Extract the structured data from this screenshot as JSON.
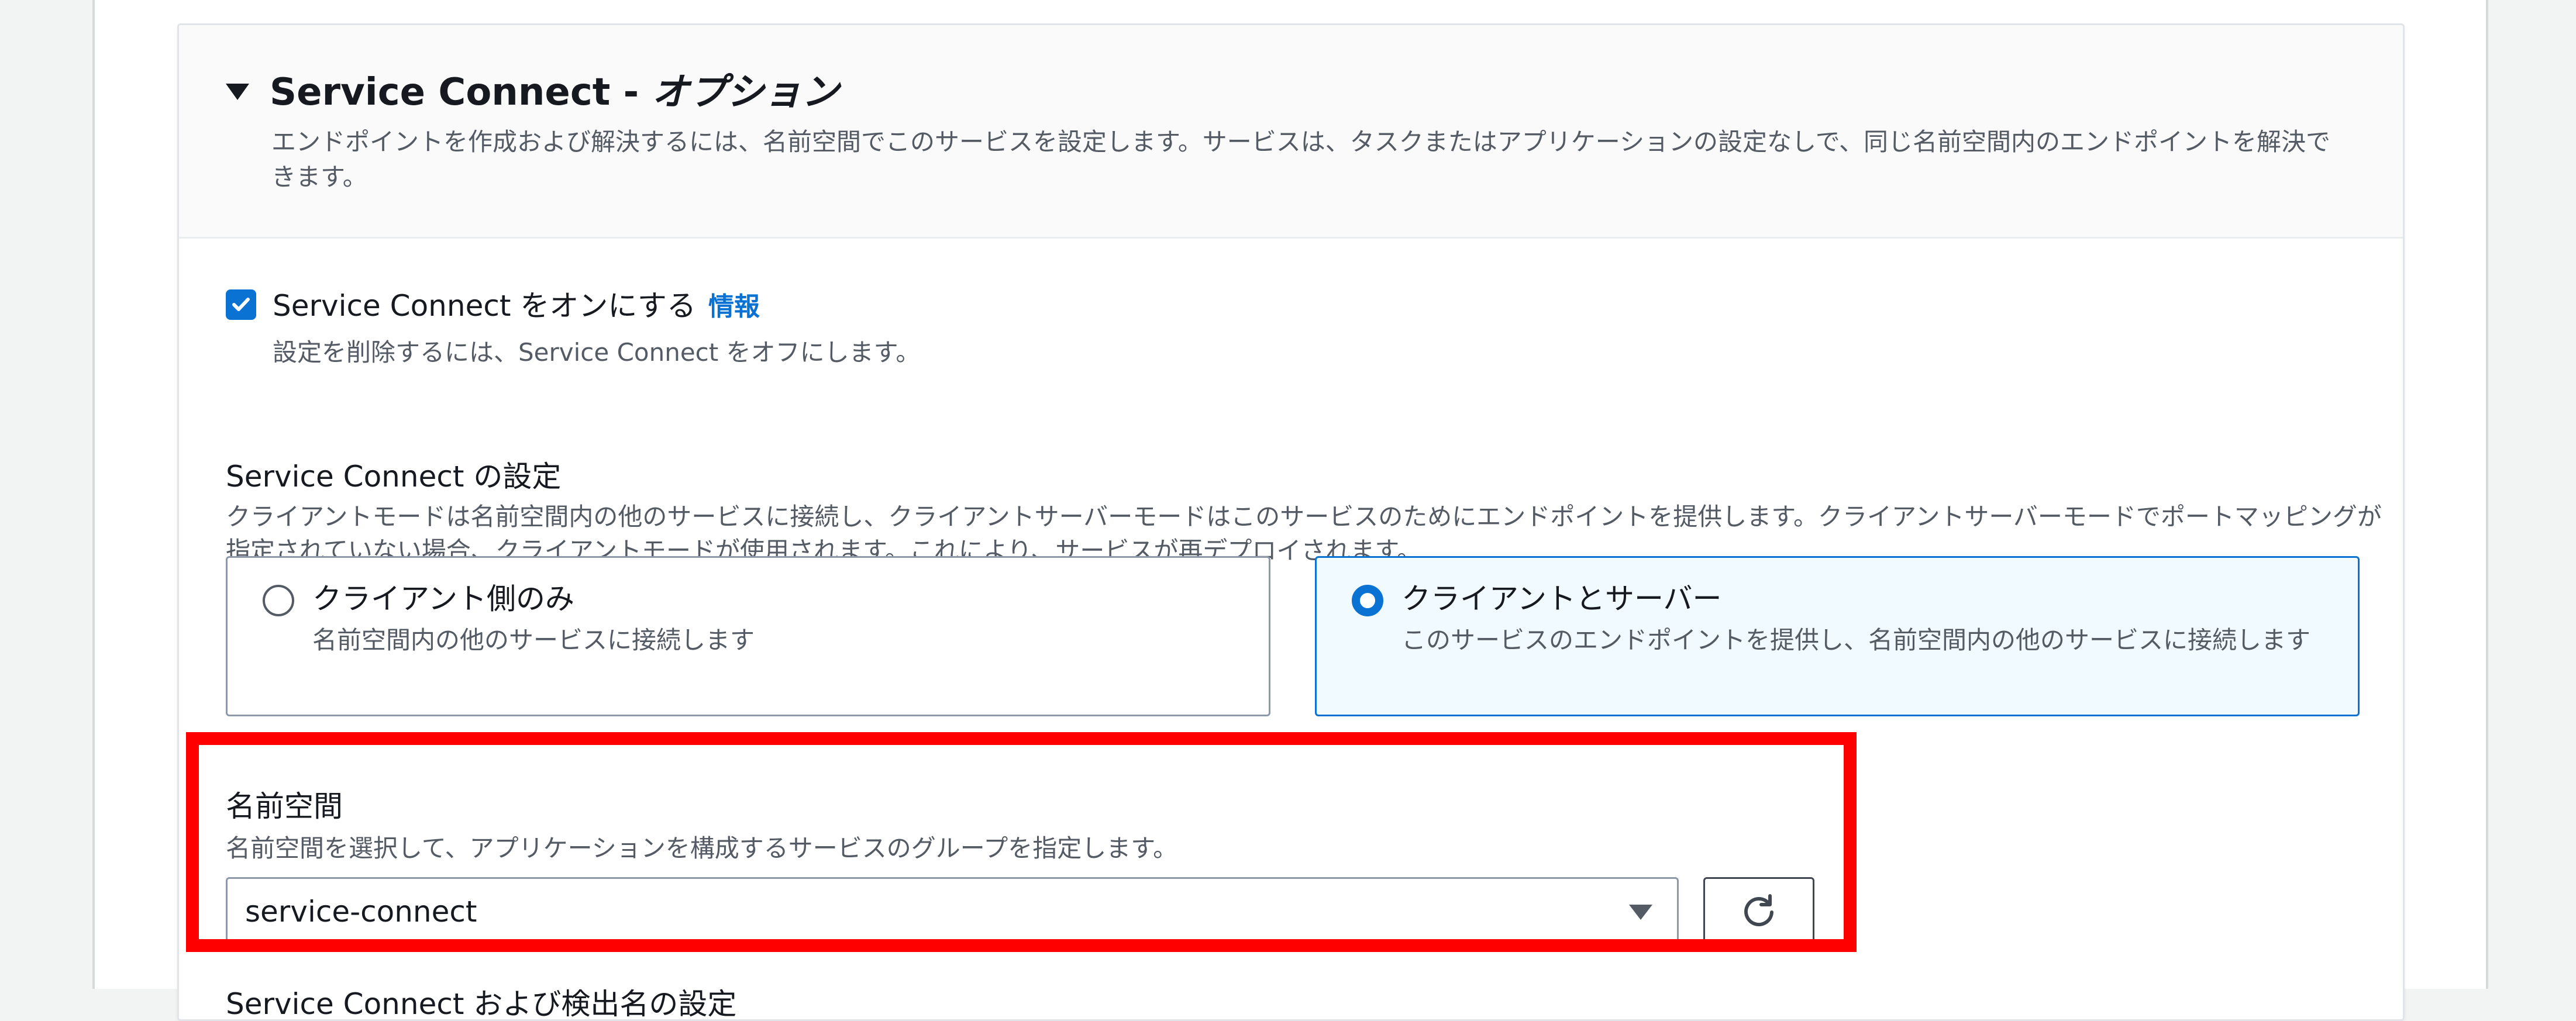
{
  "header": {
    "title_main": "Service Connect - ",
    "title_optional": "オプション",
    "description": "エンドポイントを作成および解決するには、名前空間でこのサービスを設定します。サービスは、タスクまたはアプリケーションの設定なしで、同じ名前空間内のエンドポイントを解決できます。"
  },
  "toggle": {
    "label": "Service Connect をオンにする",
    "info_link": "情報",
    "description": "設定を削除するには、Service Connect をオフにします。",
    "checked": true
  },
  "config": {
    "label": "Service Connect の設定",
    "description": "クライアントモードは名前空間内の他のサービスに接続し、クライアントサーバーモードはこのサービスのためにエンドポイントを提供します。クライアントサーバーモードでポートマッピングが指定されていない場合、クライアントモードが使用されます。これにより、サービスが再デプロイされます。",
    "options": [
      {
        "title": "クライアント側のみ",
        "description": "名前空間内の他のサービスに接続します",
        "selected": false
      },
      {
        "title": "クライアントとサーバー",
        "description": "このサービスのエンドポイントを提供し、名前空間内の他のサービスに接続します",
        "selected": true
      }
    ]
  },
  "namespace": {
    "label": "名前空間",
    "description": "名前空間を選択して、アプリケーションを構成するサービスのグループを指定します。",
    "selected_value": "service-connect"
  },
  "next_section": {
    "label": "Service Connect および検出名の設定"
  },
  "colors": {
    "accent": "#0972d3",
    "highlight": "#ff0000",
    "selected_tile_bg": "#f1faff"
  },
  "icons": {
    "caret": "caret-down-icon",
    "checkbox": "check-icon",
    "refresh": "refresh-icon"
  }
}
